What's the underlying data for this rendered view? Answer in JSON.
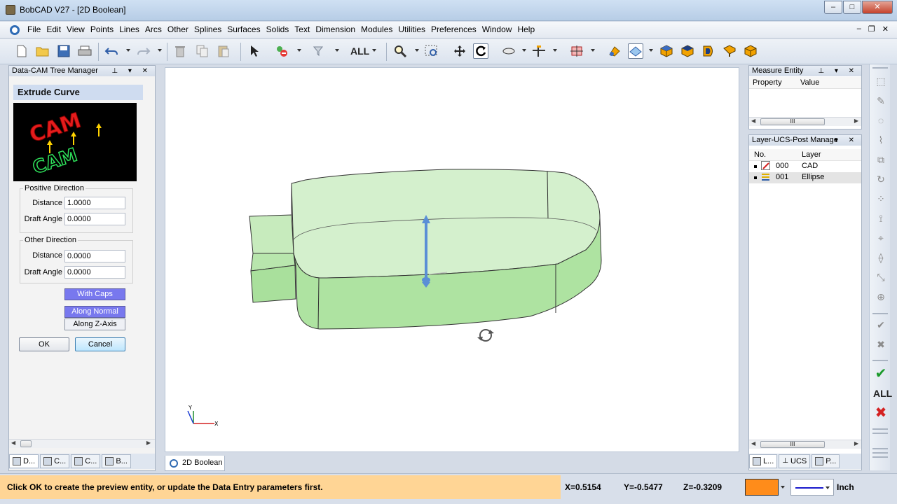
{
  "window": {
    "title": "BobCAD V27 - [2D Boolean]",
    "minimize": "–",
    "maximize": "□",
    "close": "✕"
  },
  "menu": {
    "items": [
      "File",
      "Edit",
      "View",
      "Points",
      "Lines",
      "Arcs",
      "Other",
      "Splines",
      "Surfaces",
      "Solids",
      "Text",
      "Dimension",
      "Modules",
      "Utilities",
      "Preferences",
      "Window",
      "Help"
    ],
    "mdi_minimize": "–",
    "mdi_restore": "❐",
    "mdi_close": "✕"
  },
  "toolbar": {
    "all_label": "ALL",
    "icons": [
      "new-file-icon",
      "open-folder-icon",
      "save-icon",
      "print-icon",
      "undo-icon",
      "redo-icon",
      "delete-icon",
      "copy-icon",
      "paste-icon",
      "select-arrow-icon",
      "remove-selection-icon",
      "selection-filter-icon",
      "zoom-icon",
      "zoom-window-icon",
      "pan-icon",
      "rotate-icon",
      "view-plane-icon",
      "axis-icon",
      "grid-snap-icon",
      "shaded-view-icon",
      "wireframe-view-icon",
      "iso-view-icon",
      "top-view-icon",
      "front-view-icon",
      "right-view-icon",
      "solid-view-icon"
    ]
  },
  "left_panel": {
    "title": "Data-CAM Tree Manager",
    "heading": "Extrude Curve",
    "positive_direction": {
      "label": "Positive Direction",
      "distance_label": "Distance",
      "distance_value": "1.0000",
      "draft_label": "Draft Angle",
      "draft_value": "0.0000"
    },
    "other_direction": {
      "label": "Other Direction",
      "distance_label": "Distance",
      "distance_value": "0.0000",
      "draft_label": "Draft Angle",
      "draft_value": "0.0000"
    },
    "with_caps": "With Caps",
    "along_normal": "Along Normal",
    "along_z": "Along Z-Axis",
    "ok": "OK",
    "cancel": "Cancel",
    "tabs": [
      "D...",
      "C...",
      "C...",
      "B..."
    ],
    "scroll_thumb": ""
  },
  "viewport": {
    "doc_tab": "2D Boolean",
    "axis_x": "X",
    "axis_y": "Y"
  },
  "measure_panel": {
    "title": "Measure Entity",
    "col_property": "Property",
    "col_value": "Value",
    "scroll_thumb": "III"
  },
  "layer_panel": {
    "title": "Layer-UCS-Post Manage",
    "col_no": "No.",
    "col_layer": "Layer",
    "rows": [
      {
        "no": "000",
        "name": "CAD"
      },
      {
        "no": "001",
        "name": "Ellipse"
      }
    ],
    "scroll_thumb": "III",
    "tabs": [
      "L...",
      "UCS",
      "P..."
    ]
  },
  "right_toolbar": {
    "all_label": "ALL"
  },
  "status": {
    "message": "Click OK to create the preview entity, or update the Data Entry parameters first.",
    "x": "X=0.5154",
    "y": "Y=-0.5477",
    "z": "Z=-0.3209",
    "units": "Inch",
    "color": "#ff8c1a"
  }
}
